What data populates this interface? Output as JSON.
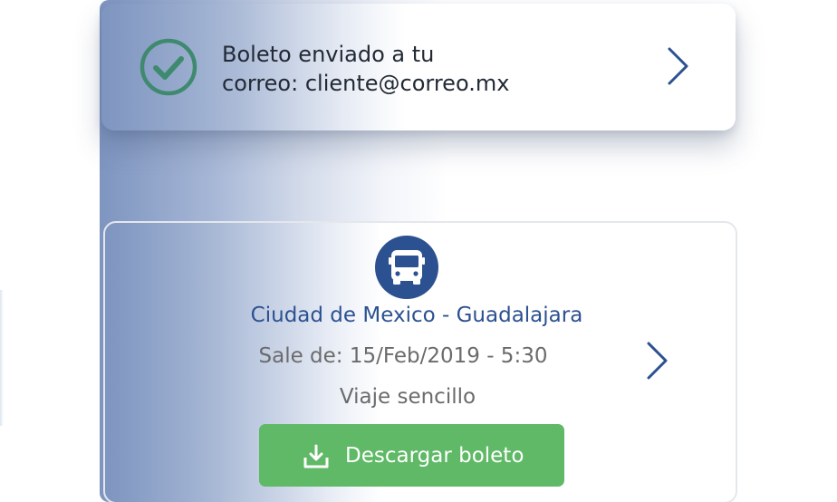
{
  "notice": {
    "line1": "Boleto enviado a tu",
    "line2": "correo: cliente@correo.mx",
    "icon": "check-circle-icon",
    "icon_color": "#3f8a6f"
  },
  "trip": {
    "route": "Ciudad de Mexico - Guadalajara",
    "departure": "Sale de: 15/Feb/2019 - 5:30",
    "trip_type": "Viaje sencillo",
    "icon": "bus-icon",
    "accent_color": "#2c5190"
  },
  "download": {
    "label": "Descargar boleto",
    "icon": "download-icon",
    "color": "#5fb966"
  }
}
